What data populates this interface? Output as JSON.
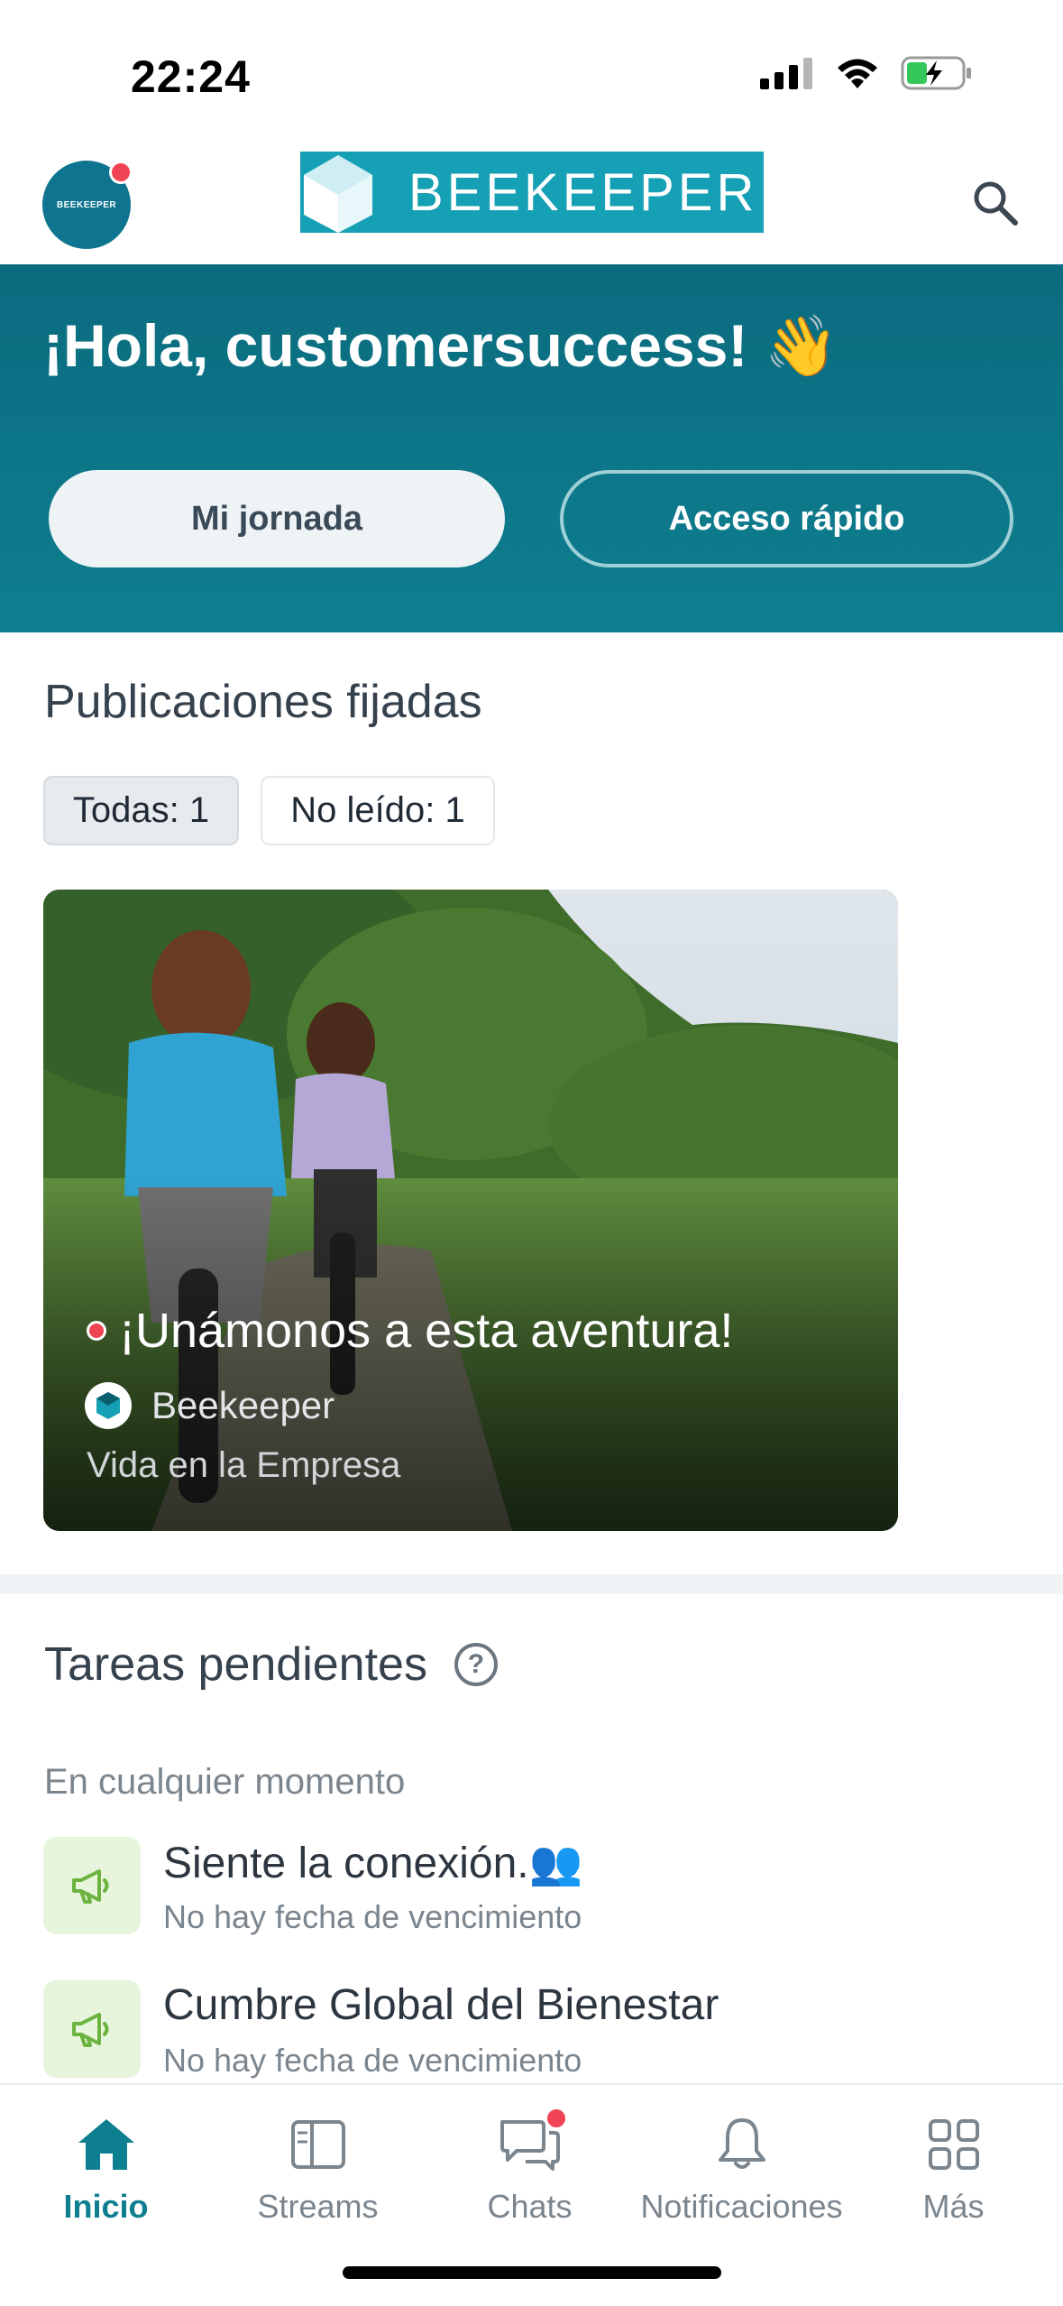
{
  "status_bar": {
    "time": "22:24"
  },
  "header": {
    "avatar_text": "BEEKEEPER",
    "logo_text": "BEEKEEPER"
  },
  "hero": {
    "greeting": "¡Hola, customersuccess! 👋",
    "primary_button": "Mi jornada",
    "secondary_button": "Acceso rápido"
  },
  "pinned": {
    "title": "Publicaciones fijadas",
    "filters": [
      {
        "label": "Todas: 1",
        "active": true
      },
      {
        "label": "No leído: 1",
        "active": false
      }
    ],
    "post": {
      "title": "¡Unámonos a esta aventura!",
      "author": "Beekeeper",
      "stream": "Vida en la Empresa",
      "unread": true
    }
  },
  "tasks": {
    "title": "Tareas pendientes",
    "help_icon": "?",
    "group_label": "En cualquier momento",
    "items": [
      {
        "title": "Siente la conexión.👥",
        "due": "No hay fecha de vencimiento",
        "icon": "megaphone-icon"
      },
      {
        "title": "Cumbre Global del Bienestar",
        "due": "No hay fecha de vencimiento",
        "icon": "megaphone-icon"
      }
    ]
  },
  "bottom_nav": {
    "items": [
      {
        "label": "Inicio",
        "icon": "home-icon",
        "active": true
      },
      {
        "label": "Streams",
        "icon": "streams-icon",
        "active": false
      },
      {
        "label": "Chats",
        "icon": "chat-icon",
        "active": false,
        "badge": true
      },
      {
        "label": "Notificaciones",
        "icon": "bell-icon",
        "active": false
      },
      {
        "label": "Más",
        "icon": "grid-icon",
        "active": false
      }
    ]
  },
  "colors": {
    "brand_teal": "#0e7f90",
    "logo_cyan": "#16a0b5",
    "badge_red": "#ef4453",
    "task_icon_bg": "#e7f5dc",
    "task_icon_fg": "#6cb33f"
  }
}
